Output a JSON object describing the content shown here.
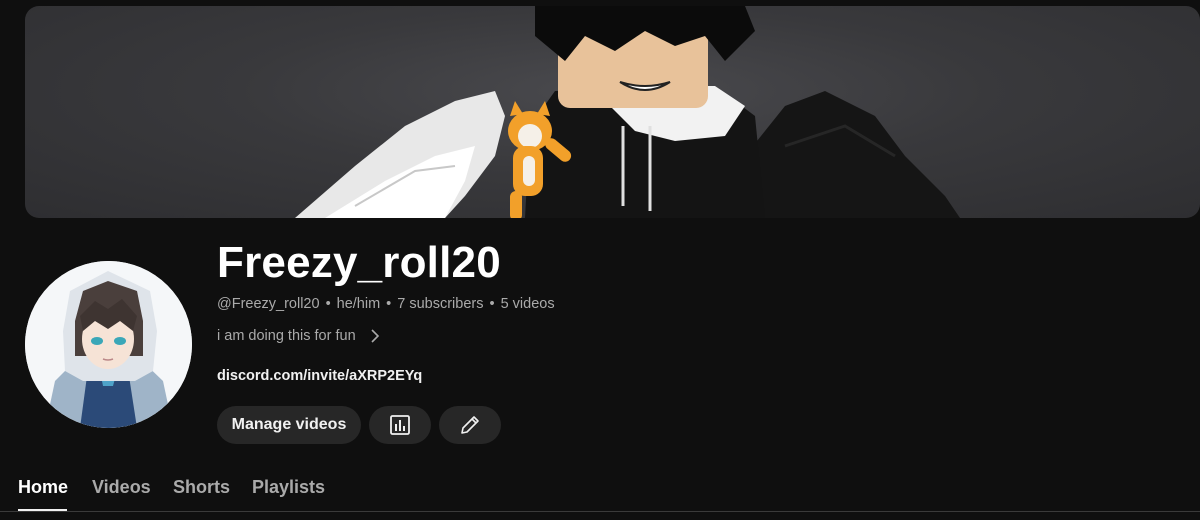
{
  "channel": {
    "name": "Freezy_roll20",
    "handle": "@Freezy_roll20",
    "pronouns": "he/him",
    "subscribers": "7 subscribers",
    "videos": "5 videos",
    "separator": "•",
    "description": "i am doing this for fun",
    "link": "discord.com/invite/aXRP2EYq"
  },
  "actions": {
    "manage_label": "Manage videos",
    "analytics_icon": "analytics-icon",
    "edit_icon": "pencil-icon"
  },
  "tabs": [
    {
      "label": "Home",
      "active": true
    },
    {
      "label": "Videos",
      "active": false
    },
    {
      "label": "Shorts",
      "active": false
    },
    {
      "label": "Playlists",
      "active": false
    }
  ],
  "colors": {
    "background": "#0f0f0f",
    "button_bg": "#272727",
    "secondary_text": "#aaaaaa",
    "primary_text": "#f1f1f1"
  }
}
